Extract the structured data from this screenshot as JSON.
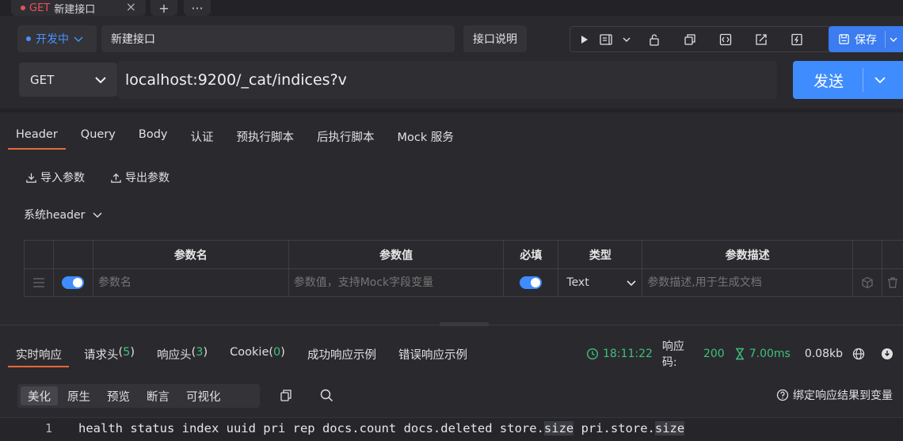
{
  "tab_strip": {
    "active_tab_method": "GET",
    "active_tab_name": "新建接口",
    "close_glyph": "×",
    "new_tab_glyph": "+",
    "more_glyph": "···"
  },
  "env": {
    "label": "开发中"
  },
  "api_name": {
    "value": "新建接口"
  },
  "desc_button": {
    "label": "接口说明"
  },
  "save_button": {
    "label": "保存"
  },
  "request": {
    "method": "GET",
    "url": "localhost:9200/_cat/indices?v",
    "send_label": "发送"
  },
  "req_tabs": [
    "Header",
    "Query",
    "Body",
    "认证",
    "预执行脚本",
    "后执行脚本",
    "Mock 服务"
  ],
  "param_actions": {
    "import_label": "导入参数",
    "export_label": "导出参数"
  },
  "system_header": {
    "label": "系统header"
  },
  "table": {
    "headers": [
      "参数名",
      "参数值",
      "必填",
      "类型",
      "参数描述"
    ],
    "row": {
      "name_placeholder": "参数名",
      "value_placeholder": "参数值，支持Mock字段变量",
      "type": "Text",
      "desc_placeholder": "参数描述,用于生成文档"
    }
  },
  "res_tabs": {
    "live": "实时响应",
    "req_headers": "请求头",
    "req_headers_count": "5",
    "res_headers": "响应头",
    "res_headers_count": "3",
    "cookie": "Cookie",
    "cookie_count": "0",
    "success_example": "成功响应示例",
    "error_example": "错误响应示例"
  },
  "status": {
    "time": "18:11:22",
    "code_label": "响应码:",
    "code": "200",
    "duration": "7.00ms",
    "size": "0.08kb"
  },
  "view_modes": [
    "美化",
    "原生",
    "预览",
    "断言",
    "可视化"
  ],
  "bind_hint": {
    "label": "绑定响应结果到变量"
  },
  "code": {
    "line_no": "1",
    "seg1": "health status index uuid pri rep docs.count docs.deleted store.",
    "seg2": "size",
    "seg3": " pri.store.",
    "seg4": "size"
  },
  "colors": {
    "accent_blue": "#3f8cff",
    "active_underline": "#e4693a",
    "success_green": "#3fc07a",
    "method_red": "#e8515a"
  }
}
